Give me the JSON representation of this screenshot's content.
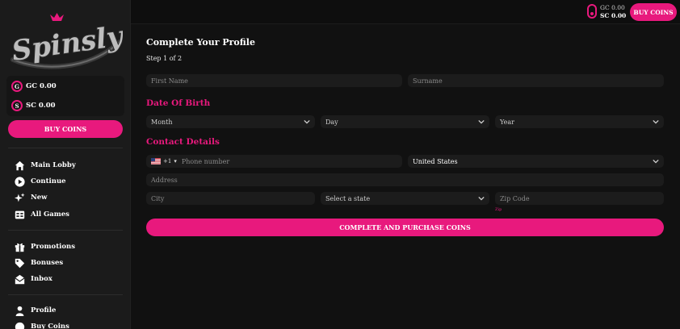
{
  "brand": {
    "logo_text": "Spinsly"
  },
  "balances": {
    "gc_label": "GC 0.00",
    "sc_label": "SC 0.00",
    "gc_icon_letter": "G",
    "sc_icon_letter": "S"
  },
  "sidebar": {
    "buy_coins": "BUY COINS",
    "groups": [
      [
        {
          "label": "Main Lobby",
          "icon": "home-icon"
        },
        {
          "label": "Continue",
          "icon": "play-icon"
        },
        {
          "label": "New",
          "icon": "sparkle-icon"
        },
        {
          "label": "All Games",
          "icon": "grid-icon"
        }
      ],
      [
        {
          "label": "Promotions",
          "icon": "gift-icon"
        },
        {
          "label": "Bonuses",
          "icon": "tag-icon"
        },
        {
          "label": "Inbox",
          "icon": "mail-icon"
        }
      ],
      [
        {
          "label": "Profile",
          "icon": "user-icon"
        },
        {
          "label": "Buy Coins",
          "icon": "coin-icon"
        }
      ]
    ]
  },
  "topbar": {
    "gc": "GC 0.00",
    "sc": "SC 0.00",
    "buy_coins": "BUY COINS"
  },
  "form": {
    "title": "Complete Your Profile",
    "step": "Step 1 of 2",
    "first_name_placeholder": "First Name",
    "surname_placeholder": "Surname",
    "dob_heading": "Date Of Birth",
    "month": "Month",
    "day": "Day",
    "year": "Year",
    "contact_heading": "Contact Details",
    "phone_prefix": "+1",
    "phone_placeholder": "Phone number",
    "country": "United States",
    "address_placeholder": "Address",
    "city_placeholder": "City",
    "state": "Select a state",
    "zip_placeholder": "Zip Code",
    "zip_hint": "Zip",
    "submit": "COMPLETE AND PURCHASE COINS"
  },
  "colors": {
    "accent": "#e8197d",
    "background": "#111111",
    "sidebar": "#1b1b1b",
    "field": "#1c1c1c"
  }
}
